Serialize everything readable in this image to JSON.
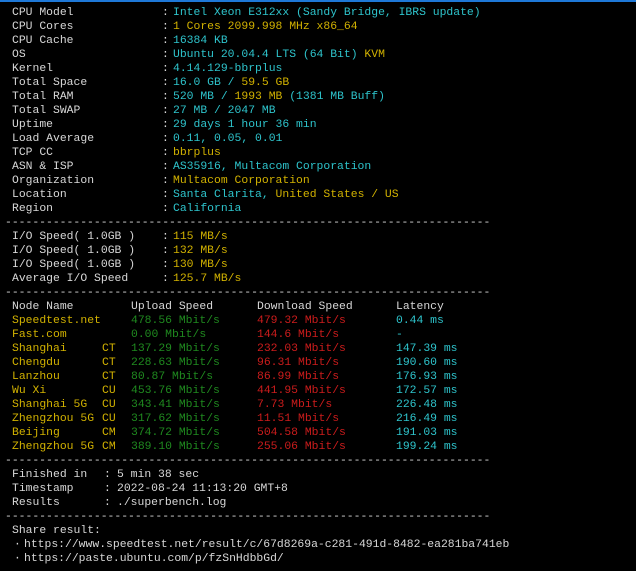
{
  "colors": {
    "cyan": "#2ec4cc",
    "yellow": "#d2b200",
    "green": "#1f8a1f",
    "red": "#cc1c1c",
    "white": "#d8d8d8",
    "background": "#000000"
  },
  "separator": "-----------------------------------------------------------------------",
  "system_info": [
    {
      "label": "CPU Model",
      "value": [
        {
          "text": "Intel Xeon E312xx (Sandy Bridge, IBRS update)",
          "color": "cyan"
        }
      ]
    },
    {
      "label": "CPU Cores",
      "value": [
        {
          "text": "1 Cores 2099.998 MHz x86_64",
          "color": "yellow"
        }
      ]
    },
    {
      "label": "CPU Cache",
      "value": [
        {
          "text": "16384 KB",
          "color": "cyan"
        }
      ]
    },
    {
      "label": "OS",
      "value": [
        {
          "text": "Ubuntu 20.04.4 LTS (64 Bit) ",
          "color": "cyan"
        },
        {
          "text": "KVM",
          "color": "yellow"
        }
      ]
    },
    {
      "label": "Kernel",
      "value": [
        {
          "text": "4.14.129-bbrplus",
          "color": "cyan"
        }
      ]
    },
    {
      "label": "Total Space",
      "value": [
        {
          "text": "16.0 GB / ",
          "color": "cyan"
        },
        {
          "text": "59.5 GB",
          "color": "yellow"
        }
      ]
    },
    {
      "label": "Total RAM",
      "value": [
        {
          "text": "520 MB / ",
          "color": "cyan"
        },
        {
          "text": "1993 MB",
          "color": "yellow"
        },
        {
          "text": " (1381 MB Buff)",
          "color": "cyan"
        }
      ]
    },
    {
      "label": "Total SWAP",
      "value": [
        {
          "text": "27 MB / 2047 MB",
          "color": "cyan"
        }
      ]
    },
    {
      "label": "Uptime",
      "value": [
        {
          "text": "29 days 1 hour 36 min",
          "color": "cyan"
        }
      ]
    },
    {
      "label": "Load Average",
      "value": [
        {
          "text": "0.11, 0.05, 0.01",
          "color": "cyan"
        }
      ]
    },
    {
      "label": "TCP CC",
      "value": [
        {
          "text": "bbrplus",
          "color": "yellow"
        }
      ]
    },
    {
      "label": "ASN & ISP",
      "value": [
        {
          "text": "AS35916, Multacom Corporation",
          "color": "cyan"
        }
      ]
    },
    {
      "label": "Organization",
      "value": [
        {
          "text": "Multacom Corporation",
          "color": "yellow"
        }
      ]
    },
    {
      "label": "Location",
      "value": [
        {
          "text": "Santa Clarita, ",
          "color": "cyan"
        },
        {
          "text": "United States / US",
          "color": "yellow"
        }
      ]
    },
    {
      "label": "Region",
      "value": [
        {
          "text": "California",
          "color": "cyan"
        }
      ]
    }
  ],
  "io": [
    {
      "label": "I/O Speed( 1.0GB )",
      "value": "115 MB/s"
    },
    {
      "label": "I/O Speed( 1.0GB )",
      "value": "132 MB/s"
    },
    {
      "label": "I/O Speed( 1.0GB )",
      "value": "130 MB/s"
    },
    {
      "label": "Average I/O Speed",
      "value": "125.7 MB/s"
    }
  ],
  "speed": {
    "headers": {
      "node": "Node Name",
      "upload": "Upload Speed",
      "download": "Download Speed",
      "latency": "Latency"
    },
    "rows": [
      {
        "node": "Speedtest.net",
        "isp": "",
        "upload": "478.56 Mbit/s",
        "download": "479.32 Mbit/s",
        "latency": "0.44 ms"
      },
      {
        "node": "Fast.com",
        "isp": "",
        "upload": "0.00 Mbit/s",
        "download": "144.6 Mbit/s",
        "latency": "-"
      },
      {
        "node": "Shanghai",
        "isp": "CT",
        "upload": "137.29 Mbit/s",
        "download": "232.03 Mbit/s",
        "latency": "147.39 ms"
      },
      {
        "node": "Chengdu",
        "isp": "CT",
        "upload": "228.63 Mbit/s",
        "download": "96.31 Mbit/s",
        "latency": "190.60 ms"
      },
      {
        "node": "Lanzhou",
        "isp": "CT",
        "upload": "80.87 Mbit/s",
        "download": "86.99 Mbit/s",
        "latency": "176.93 ms"
      },
      {
        "node": "Wu Xi",
        "isp": "CU",
        "upload": "453.76 Mbit/s",
        "download": "441.95 Mbit/s",
        "latency": "172.57 ms"
      },
      {
        "node": "Shanghai 5G",
        "isp": "CU",
        "upload": "343.41 Mbit/s",
        "download": "7.73 Mbit/s",
        "latency": "226.48 ms"
      },
      {
        "node": "Zhengzhou 5G",
        "isp": "CU",
        "upload": "317.62 Mbit/s",
        "download": "11.51 Mbit/s",
        "latency": "216.49 ms"
      },
      {
        "node": "Beijing",
        "isp": "CM",
        "upload": "374.72 Mbit/s",
        "download": "504.58 Mbit/s",
        "latency": "191.03 ms"
      },
      {
        "node": "Zhengzhou 5G",
        "isp": "CM",
        "upload": "389.10 Mbit/s",
        "download": "255.06 Mbit/s",
        "latency": "199.24 ms"
      }
    ]
  },
  "summary": [
    {
      "label": "Finished in",
      "value": "5 min 38 sec"
    },
    {
      "label": "Timestamp",
      "value": "2022-08-24 11:13:20 GMT+8"
    },
    {
      "label": "Results",
      "value": "./superbench.log"
    }
  ],
  "share": {
    "title": "Share result:",
    "bullet": "·",
    "links": [
      "https://www.speedtest.net/result/c/67d8269a-c281-491d-8482-ea281ba741eb",
      "https://paste.ubuntu.com/p/fzSnHdbbGd/"
    ]
  }
}
